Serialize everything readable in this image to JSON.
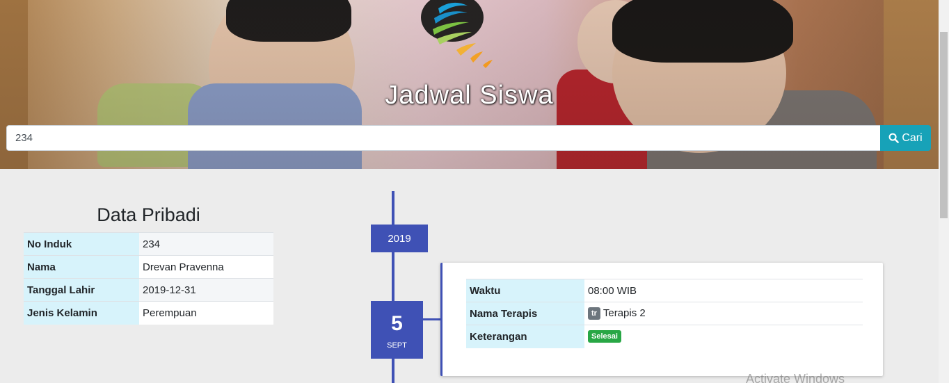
{
  "header": {
    "title": "Jadwal Siswa",
    "search": {
      "value": "234",
      "button_label": "Cari"
    }
  },
  "pribadi": {
    "title": "Data Pribadi",
    "rows": [
      {
        "label": "No Induk",
        "value": "234"
      },
      {
        "label": "Nama",
        "value": "Drevan Pravenna"
      },
      {
        "label": "Tanggal Lahir",
        "value": "2019-12-31"
      },
      {
        "label": "Jenis Kelamin",
        "value": "Perempuan"
      }
    ]
  },
  "timeline": {
    "year": "2019",
    "entry": {
      "day": "5",
      "month": "SEPT",
      "rows": {
        "waktu": {
          "label": "Waktu",
          "value": "08:00 WIB"
        },
        "terapis": {
          "label": "Nama Terapis",
          "badge": "tr",
          "value": "Terapis 2"
        },
        "keterangan": {
          "label": "Keterangan",
          "badge": "Selesai"
        }
      }
    }
  },
  "watermark": "Activate Windows",
  "colors": {
    "primary": "#3f51b5",
    "search_button": "#17a2b8",
    "success": "#28a745",
    "label_bg": "#d7f3fb"
  }
}
